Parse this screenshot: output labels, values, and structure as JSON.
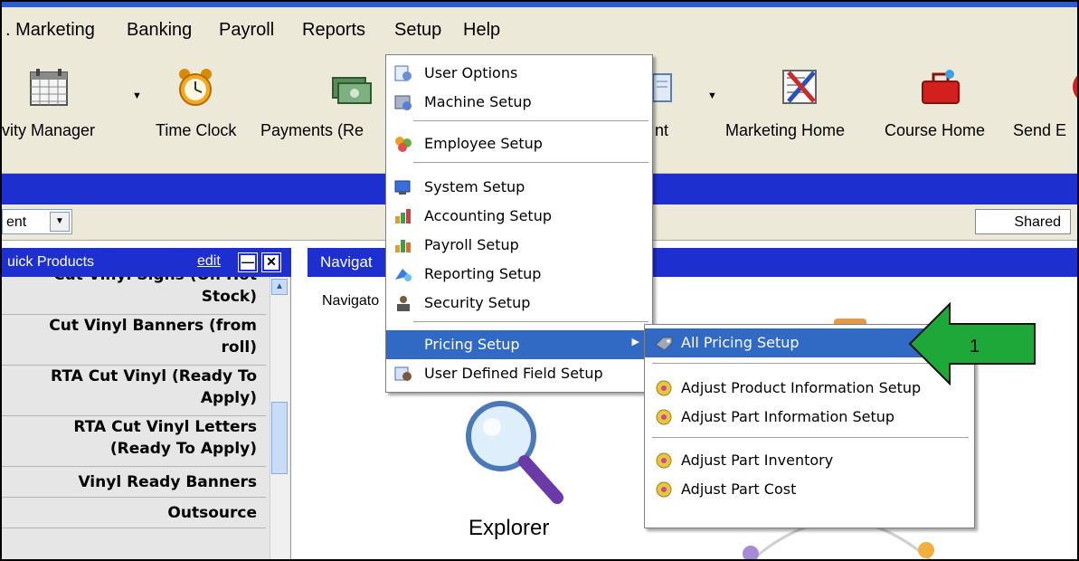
{
  "menubar": {
    "items": [
      {
        "label": ". Marketing",
        "underline": "M"
      },
      {
        "label": "Banking",
        "underline": "B"
      },
      {
        "label": "Payroll",
        "underline": "P"
      },
      {
        "label": "Reports",
        "underline": "R"
      },
      {
        "label": "Setup",
        "underline": "e"
      },
      {
        "label": "Help",
        "underline": "H"
      }
    ]
  },
  "toolbar": {
    "items": [
      {
        "label": "vity Manager"
      },
      {
        "label": "Time Clock"
      },
      {
        "label": "Payments (Re"
      },
      {
        "label": "nt"
      },
      {
        "label": "Marketing Home"
      },
      {
        "label": "Course Home"
      },
      {
        "label": "Send E"
      }
    ]
  },
  "filter": {
    "combo_value": "ent",
    "shared_label": "Shared"
  },
  "left_panel": {
    "title": "uick Products",
    "edit_label": "edit",
    "minimize_glyph": "—",
    "close_glyph": "✕",
    "items": [
      [
        "Cut Vinyl Signs (On Hot",
        "Stock)"
      ],
      [
        "Cut Vinyl Banners (from",
        "roll)"
      ],
      [
        "RTA Cut Vinyl (Ready To",
        "Apply)"
      ],
      [
        "RTA Cut Vinyl Letters",
        "(Ready To Apply)"
      ],
      [
        "Vinyl Ready Banners"
      ],
      [
        "Outsource"
      ]
    ]
  },
  "right_panel": {
    "title": "Navigat",
    "label": "Navigato",
    "explorer_label": "Explorer"
  },
  "setup_menu": {
    "items": [
      {
        "label": "User Options",
        "icon": "user-options-icon"
      },
      {
        "label": "Machine Setup",
        "icon": "machine-icon"
      },
      {
        "label": "Employee Setup",
        "icon": "employees-icon"
      },
      {
        "label": "System Setup",
        "icon": "system-icon"
      },
      {
        "label": "Accounting Setup",
        "icon": "accounting-icon"
      },
      {
        "label": "Payroll Setup",
        "icon": "payroll-icon"
      },
      {
        "label": "Reporting Setup",
        "icon": "reporting-icon"
      },
      {
        "label": "Security Setup",
        "icon": "security-icon"
      },
      {
        "label": "Pricing Setup",
        "icon": "",
        "has_submenu": true,
        "highlighted": true
      },
      {
        "label": "User Defined Field Setup",
        "icon": "user-defined-field-icon"
      }
    ]
  },
  "pricing_submenu": {
    "items": [
      {
        "label": "All Pricing Setup",
        "icon": "pricing-tag-icon",
        "highlighted": true
      },
      {
        "label": "Adjust Product Information Setup",
        "icon": "adjust-gear-icon"
      },
      {
        "label": "Adjust Part Information Setup",
        "icon": "adjust-gear-icon"
      },
      {
        "label": "Adjust Part Inventory",
        "icon": "adjust-gear-icon"
      },
      {
        "label": "Adjust Part Cost",
        "icon": "adjust-gear-icon"
      }
    ]
  },
  "callout": {
    "number": "1",
    "color": "#1fa83a"
  },
  "colors": {
    "menu_highlight": "#316ac5",
    "panel_header": "#1e2fcf",
    "chrome": "#ece9d8"
  }
}
